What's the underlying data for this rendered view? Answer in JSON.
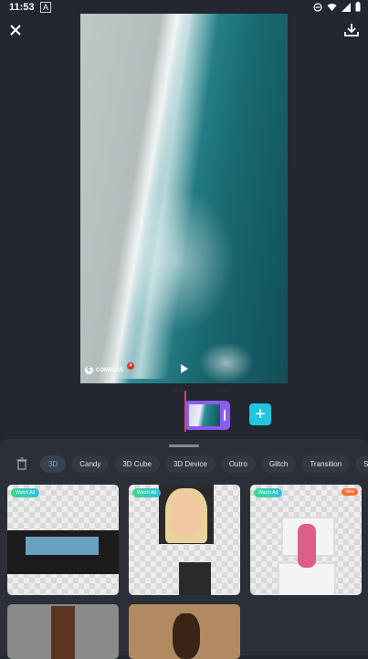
{
  "status_bar": {
    "time": "11:53",
    "notification_icon": "A"
  },
  "preview": {
    "watermark_text": "COMPOSE"
  },
  "panel": {
    "tabs": [
      {
        "label": "3D",
        "active": true
      },
      {
        "label": "Candy",
        "active": false
      },
      {
        "label": "3D Cube",
        "active": false
      },
      {
        "label": "3D Device",
        "active": false
      },
      {
        "label": "Outro",
        "active": false
      },
      {
        "label": "Glitch",
        "active": false
      },
      {
        "label": "Transition",
        "active": false
      },
      {
        "label": "Spin",
        "active": false
      }
    ],
    "cards": [
      {
        "badge": "Watch Ad"
      },
      {
        "badge": "Watch Ad"
      },
      {
        "badge": "Watch Ad",
        "new_label": "New"
      },
      {},
      {}
    ]
  },
  "colors": {
    "background": "#232730",
    "panel": "#2b2f38",
    "accent_cyan": "#1ec6e0",
    "clip_purple": "#8c5bf0",
    "playhead": "#e23a7b"
  }
}
